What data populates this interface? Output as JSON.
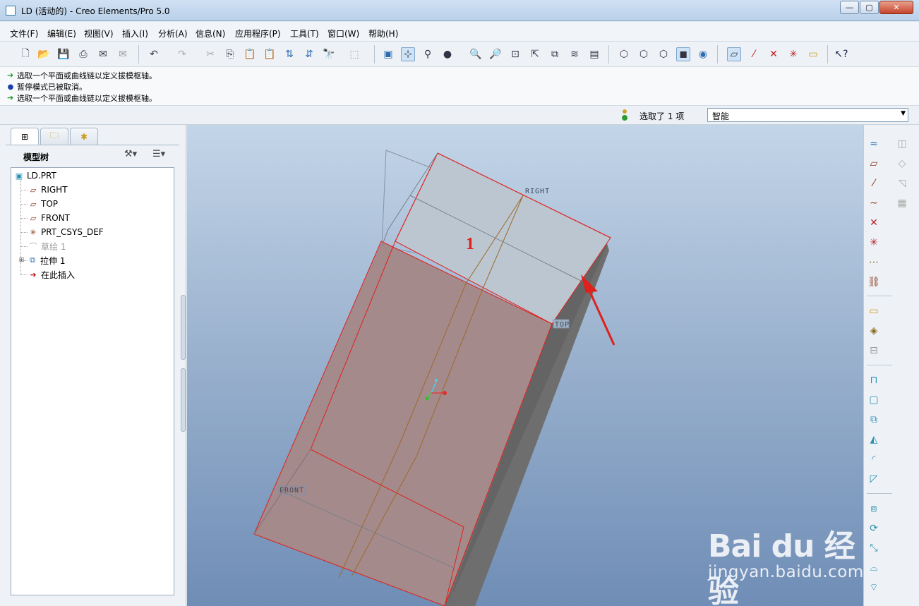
{
  "window": {
    "title": "LD (活动的) - Creo Elements/Pro 5.0",
    "minimize": "—",
    "maximize": "▢",
    "close": "✕"
  },
  "menu": [
    "文件(F)",
    "编辑(E)",
    "视图(V)",
    "插入(I)",
    "分析(A)",
    "信息(N)",
    "应用程序(P)",
    "工具(T)",
    "窗口(W)",
    "帮助(H)"
  ],
  "messages": [
    {
      "type": "prompt",
      "text": "选取一个平面或曲线链以定义拔模枢轴。"
    },
    {
      "type": "info",
      "text": "暂停模式已被取消。"
    },
    {
      "type": "prompt",
      "text": "选取一个平面或曲线链以定义拔模枢轴。"
    }
  ],
  "status": {
    "selected": "选取了 1 项",
    "filter": "智能"
  },
  "model_tree": {
    "header": "模型树",
    "items": [
      {
        "label": "LD.PRT",
        "icon": "part-icon",
        "dim": false
      },
      {
        "label": "RIGHT",
        "icon": "datum-plane-icon",
        "dim": false
      },
      {
        "label": "TOP",
        "icon": "datum-plane-icon",
        "dim": false
      },
      {
        "label": "FRONT",
        "icon": "datum-plane-icon",
        "dim": false
      },
      {
        "label": "PRT_CSYS_DEF",
        "icon": "csys-icon",
        "dim": false
      },
      {
        "label": "草绘 1",
        "icon": "sketch-icon",
        "dim": true
      },
      {
        "label": "拉伸 1",
        "icon": "extrude-icon",
        "dim": false
      },
      {
        "label": "在此插入",
        "icon": "insert-here-icon",
        "dim": false
      }
    ]
  },
  "viewport": {
    "datum_labels": {
      "right": "RIGHT",
      "top": "TOP",
      "front": "FRONT"
    },
    "annotation": "1",
    "colors": {
      "highlight": "#e0201a",
      "face_selected": "#a58a8c",
      "face_top": "#b8c5d3",
      "face_side": "#6b6b6b",
      "curve": "#9b6a2a"
    }
  },
  "watermark": {
    "brand": "Bai du 经验",
    "url": "jingyan.baidu.com"
  }
}
